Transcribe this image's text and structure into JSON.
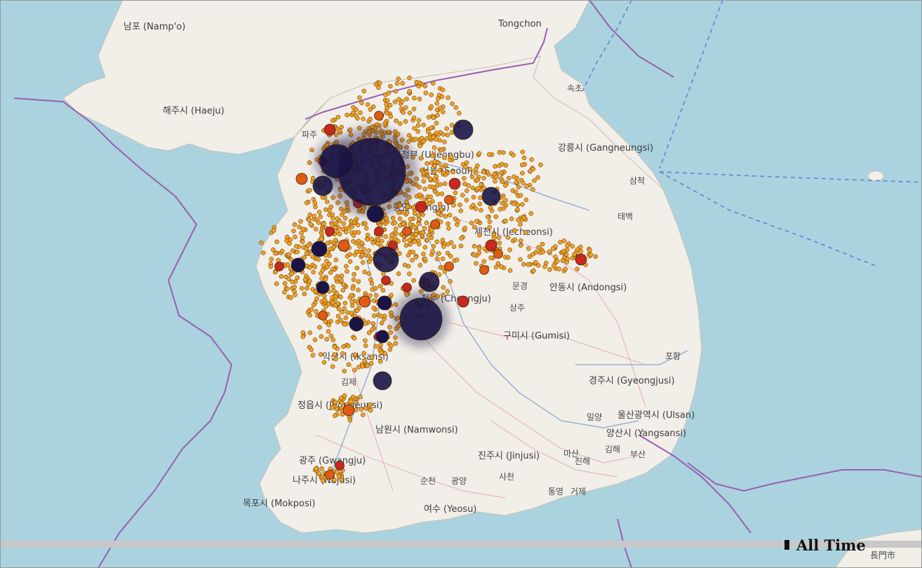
{
  "map": {
    "sea_color": "#aad3df",
    "land_color": "#f2efe9",
    "border_color": "#9a5fb0",
    "labels": [
      {
        "text": "남포 (Namp'o)",
        "type": "city"
      },
      {
        "text": "Tongchon",
        "type": "city"
      },
      {
        "text": "해주시 (Haeju)",
        "type": "city"
      },
      {
        "text": "속초",
        "type": "town"
      },
      {
        "text": "파주",
        "type": "town"
      },
      {
        "text": "강릉시 (Gangneungsi)",
        "type": "city"
      },
      {
        "text": "삼척",
        "type": "town"
      },
      {
        "text": "태백",
        "type": "town"
      },
      {
        "text": "제천시 (Jecheonsi)",
        "type": "city"
      },
      {
        "text": "안동시 (Andongsi)",
        "type": "city"
      },
      {
        "text": "문경",
        "type": "town"
      },
      {
        "text": "상주",
        "type": "town"
      },
      {
        "text": "구미시 (Gumisi)",
        "type": "city"
      },
      {
        "text": "포항",
        "type": "town"
      },
      {
        "text": "경주시 (Gyeongjusi)",
        "type": "city"
      },
      {
        "text": "울산광역시 (Ulsan)",
        "type": "city"
      },
      {
        "text": "밀양",
        "type": "town"
      },
      {
        "text": "양산시 (Yangsansi)",
        "type": "city"
      },
      {
        "text": "김해",
        "type": "town"
      },
      {
        "text": "부산",
        "type": "town"
      },
      {
        "text": "진주시 (Jinjusi)",
        "type": "city"
      },
      {
        "text": "마산",
        "type": "town"
      },
      {
        "text": "진해",
        "type": "town"
      },
      {
        "text": "사천",
        "type": "town"
      },
      {
        "text": "통영",
        "type": "town"
      },
      {
        "text": "거제",
        "type": "town"
      },
      {
        "text": "남원시 (Namwonsi)",
        "type": "city"
      },
      {
        "text": "순천",
        "type": "town"
      },
      {
        "text": "광양",
        "type": "town"
      },
      {
        "text": "여수 (Yeosu)",
        "type": "city"
      },
      {
        "text": "목포시 (Mokposi)",
        "type": "city"
      },
      {
        "text": "나주시 (Najusi)",
        "type": "city"
      },
      {
        "text": "광주 (Gwangju)",
        "type": "city"
      },
      {
        "text": "정읍시 (Jeongeupsi)",
        "type": "city"
      },
      {
        "text": "김제",
        "type": "town"
      },
      {
        "text": "익산시 (Iksansi)",
        "type": "city"
      },
      {
        "text": "청주 (Cheongju)",
        "type": "city"
      },
      {
        "text": "용인 (Yongin)",
        "type": "city"
      },
      {
        "text": "서울 (Seoul)",
        "type": "city"
      },
      {
        "text": "의정부 (Uijeongbu)",
        "type": "city"
      },
      {
        "text": "長門市",
        "type": "town"
      }
    ]
  },
  "markers": {
    "colors": {
      "small": "#f5a020",
      "medium": "#e05a14",
      "large": "#c8281e",
      "xlarge": "#1a1446"
    }
  },
  "legend": {
    "label": "All Time"
  }
}
